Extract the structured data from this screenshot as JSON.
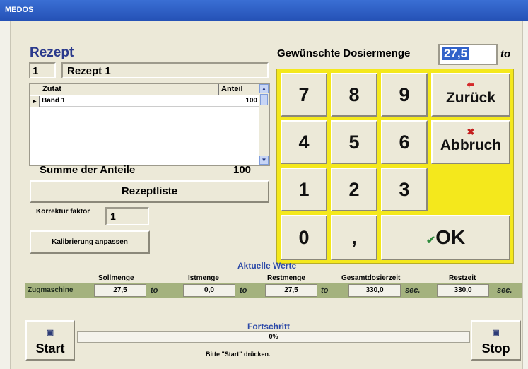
{
  "window": {
    "title": "MEDOS"
  },
  "rezept": {
    "heading": "Rezept",
    "number": "1",
    "name": "Rezept 1",
    "table": {
      "col_zutat": "Zutat",
      "col_anteil": "Anteil",
      "rows": [
        {
          "zutat": "Band 1",
          "anteil": "100"
        }
      ]
    },
    "summe_label": "Summe der Anteile",
    "summe_value": "100",
    "rezeptliste_label": "Rezeptliste",
    "korrektur_label": "Korrektur faktor",
    "korrektur_value": "1",
    "kalibrierung_label": "Kalibrierung anpassen"
  },
  "dosierung": {
    "label": "Gewünschte Dosiermenge",
    "value": "27,5",
    "unit": "to"
  },
  "keypad": {
    "color": "#f4e81c",
    "keys": {
      "k7": "7",
      "k8": "8",
      "k9": "9",
      "k4": "4",
      "k5": "5",
      "k6": "6",
      "k1": "1",
      "k2": "2",
      "k3": "3",
      "k0": "0",
      "comma": ","
    },
    "zurueck_label": "Zurück",
    "abbruch_label": "Abbruch",
    "ok_label": "OK"
  },
  "aktuelle": {
    "heading": "Aktuelle Werte",
    "columns": {
      "soll": "Sollmenge",
      "ist": "Istmenge",
      "rest": "Restmenge",
      "gesamt": "Gesamtdosierzeit",
      "restzeit": "Restzeit"
    },
    "row": {
      "name": "Zugmaschine",
      "soll": "27,5",
      "soll_unit": "to",
      "ist": "0,0",
      "ist_unit": "to",
      "rest": "27,5",
      "rest_unit": "to",
      "gesamt": "330,0",
      "gesamt_unit": "sec.",
      "restzeit": "330,0",
      "restzeit_unit": "sec."
    }
  },
  "fortschritt": {
    "label": "Fortschritt",
    "value_text": "0%",
    "fraction": 0,
    "hint": "Bitte \"Start\" drücken."
  },
  "controls": {
    "start_label": "Start",
    "stop_label": "Stop"
  }
}
